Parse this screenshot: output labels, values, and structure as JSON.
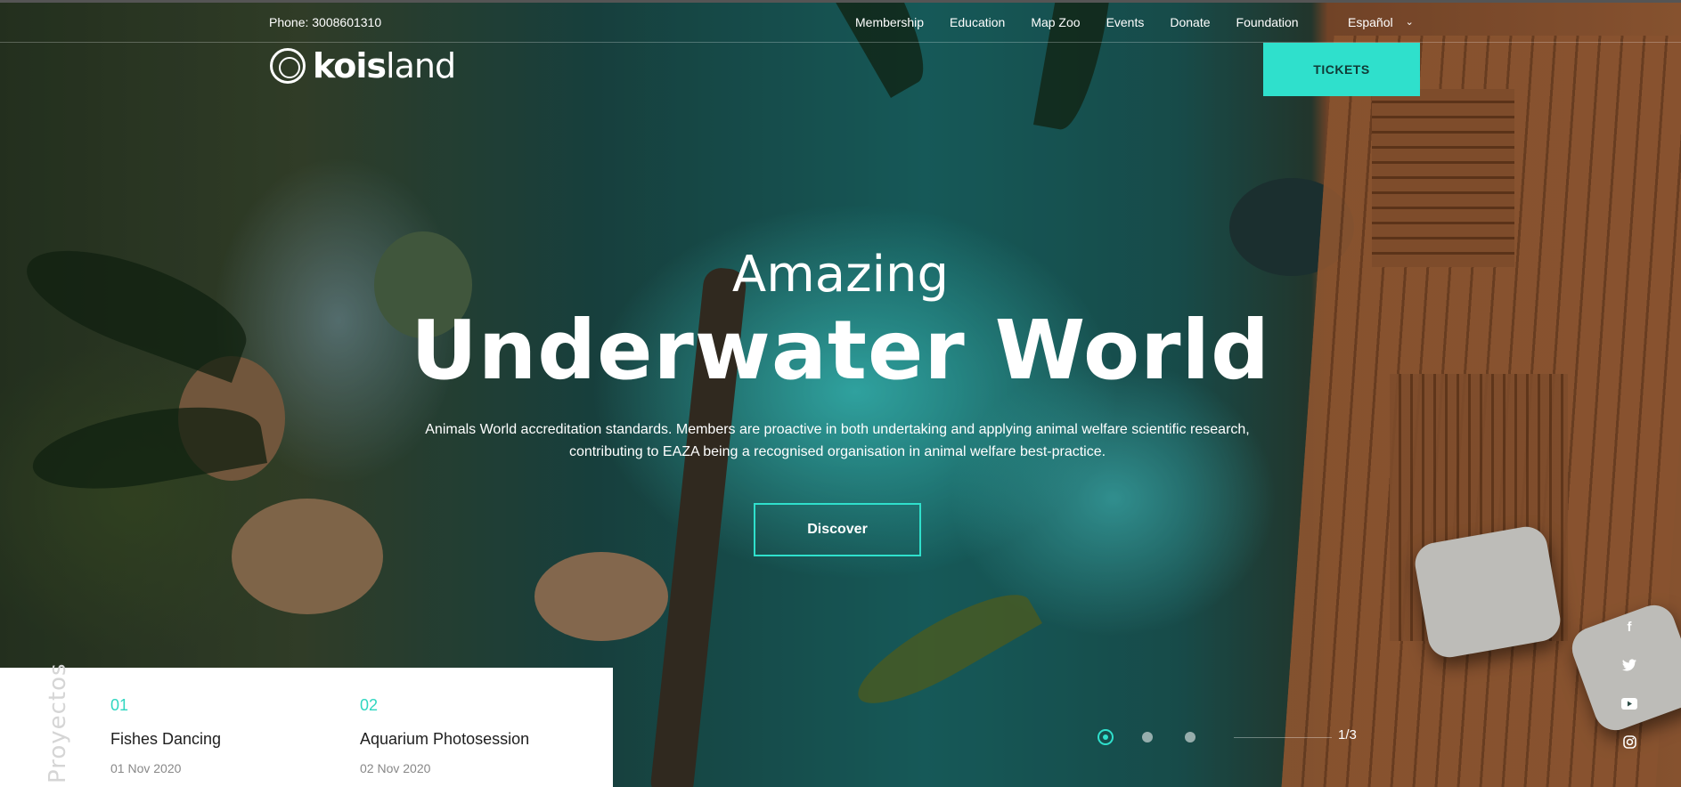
{
  "header": {
    "phone": "Phone: 3008601310",
    "nav": [
      "Membership",
      "Education",
      "Map Zoo",
      "Events",
      "Donate",
      "Foundation"
    ],
    "language": "Español",
    "logo": {
      "bold": "kois",
      "light": "land"
    },
    "tickets_label": "TICKETS"
  },
  "hero": {
    "kicker": "Amazing",
    "title": "Underwater World",
    "description_line1": "Animals World accreditation standards. Members are proactive in both undertaking and applying animal welfare scientific research,",
    "description_line2": "contributing to EAZA being a recognised organisation in animal welfare best-practice.",
    "cta_label": "Discover"
  },
  "slider": {
    "counter": "1/3",
    "current": 1,
    "total": 3
  },
  "social": {
    "facebook": "f",
    "twitter": "🐦",
    "youtube": "▶",
    "instagram": "◎"
  },
  "projects": {
    "label": "Proyectos",
    "items": [
      {
        "number": "01",
        "title": "Fishes Dancing",
        "date": "01 Nov 2020"
      },
      {
        "number": "02",
        "title": "Aquarium Photosession",
        "date": "02 Nov 2020"
      }
    ]
  },
  "colors": {
    "accent": "#2fe0cc",
    "panel_bg": "#ffffff"
  }
}
